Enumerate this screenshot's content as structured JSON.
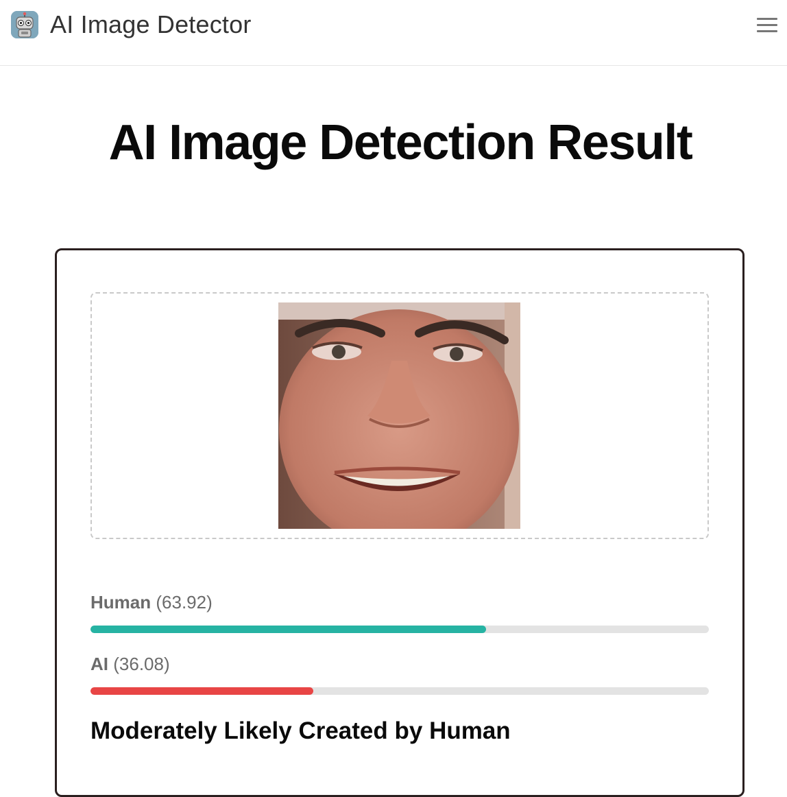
{
  "header": {
    "app_title": "AI Image Detector",
    "logo_icon": "robot-logo-icon",
    "menu_icon": "hamburger-menu-icon"
  },
  "main": {
    "page_title": "AI Image Detection Result"
  },
  "result": {
    "human": {
      "label": "Human",
      "value_text": "(63.92)",
      "percent": 63.92,
      "color": "#26b3a3"
    },
    "ai": {
      "label": "AI",
      "value_text": "(36.08)",
      "percent": 36.08,
      "color": "#e84545"
    },
    "verdict": "Moderately Likely Created by Human"
  }
}
